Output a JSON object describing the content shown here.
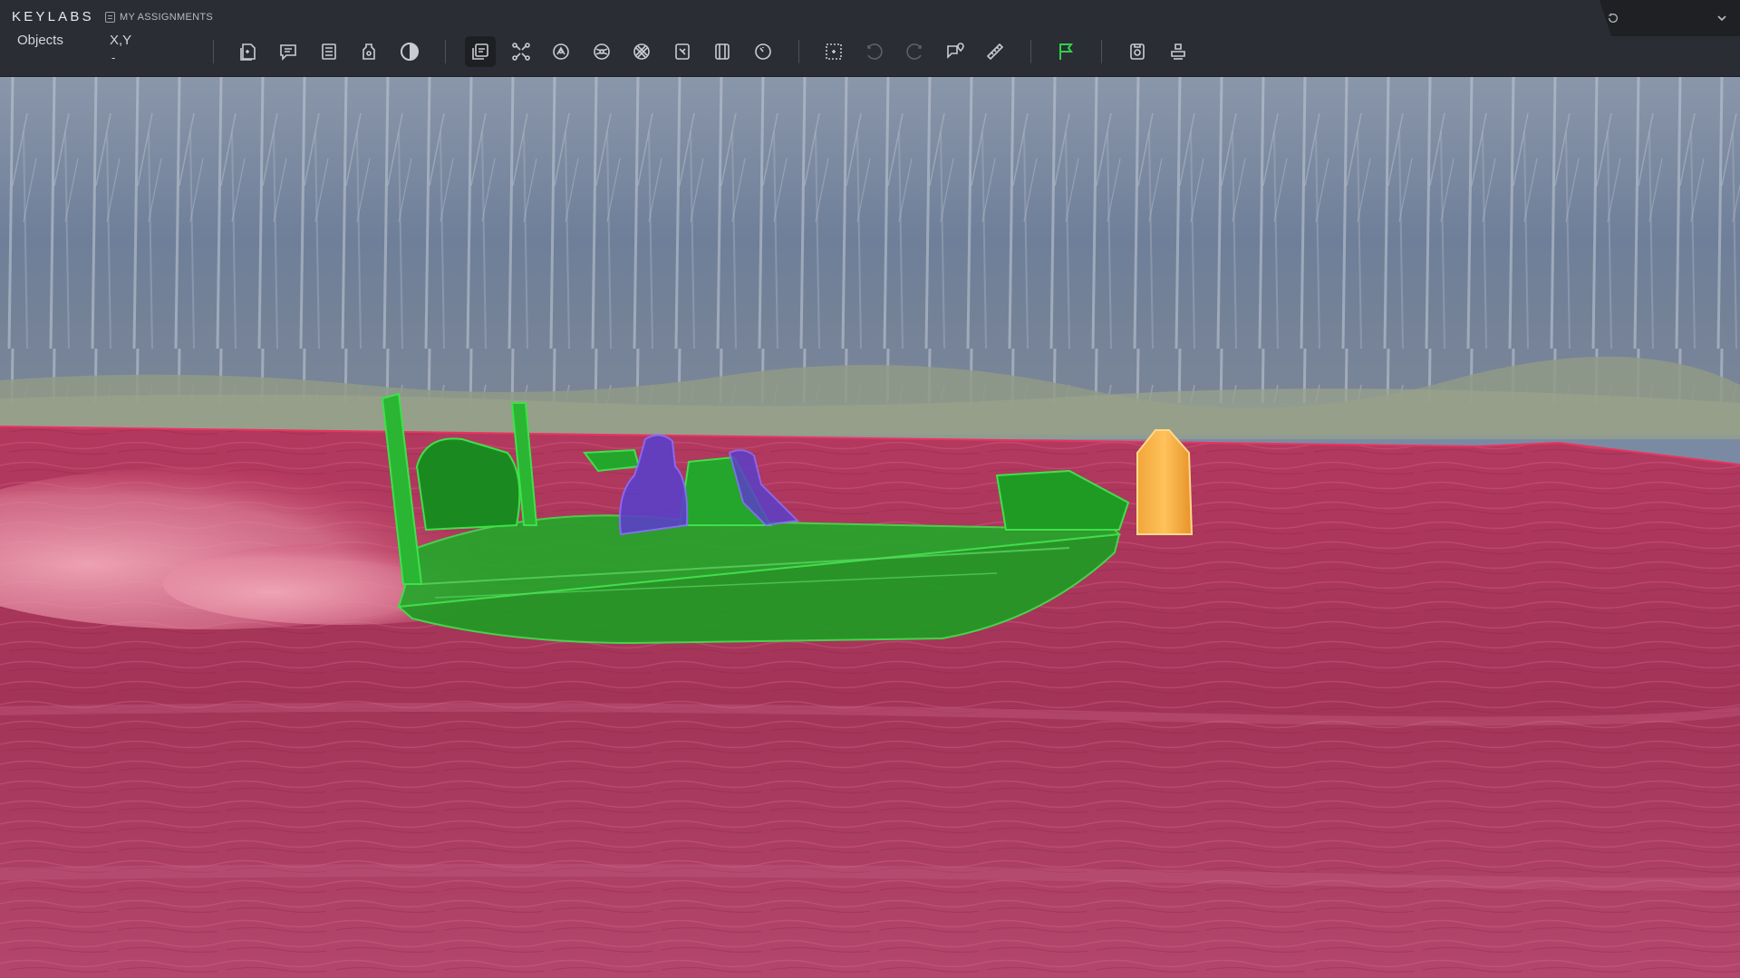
{
  "app": {
    "brand": "KEYLABS",
    "assignments_label": "MY ASSIGNMENTS"
  },
  "toolbar": {
    "objects_label": "Objects",
    "coords_label": "X,Y",
    "coords_value": "-",
    "tools": [
      {
        "name": "objects-panel-icon",
        "state": "normal"
      },
      {
        "name": "comments-icon",
        "state": "normal"
      },
      {
        "name": "attributes-list-icon",
        "state": "normal"
      },
      {
        "name": "tag-icon",
        "state": "normal"
      },
      {
        "name": "contrast-icon",
        "state": "normal"
      },
      {
        "name": "layers-icon",
        "state": "active"
      },
      {
        "name": "polygon-points-icon",
        "state": "normal"
      },
      {
        "name": "smart-segment-icon",
        "state": "normal"
      },
      {
        "name": "mask-icon",
        "state": "normal"
      },
      {
        "name": "hatch-icon",
        "state": "normal"
      },
      {
        "name": "auto-annotate-icon",
        "state": "normal"
      },
      {
        "name": "frame-icon",
        "state": "normal"
      },
      {
        "name": "timer-icon",
        "state": "normal"
      },
      {
        "name": "select-region-icon",
        "state": "normal"
      },
      {
        "name": "undo-icon",
        "state": "disabled"
      },
      {
        "name": "redo-icon",
        "state": "disabled"
      },
      {
        "name": "comment-pin-icon",
        "state": "normal"
      },
      {
        "name": "ruler-icon",
        "state": "normal"
      },
      {
        "name": "flag-icon",
        "state": "highlighted"
      },
      {
        "name": "save-icon",
        "state": "normal"
      },
      {
        "name": "stamp-icon",
        "state": "normal"
      }
    ]
  },
  "annotation_colors": {
    "water": "#c2325e",
    "boat": "#1fa81f",
    "person": "#6b3fd6",
    "buoy": "#f2a63a",
    "flag_active": "#2fd04a"
  },
  "image_layer": "boat-annotation-image"
}
